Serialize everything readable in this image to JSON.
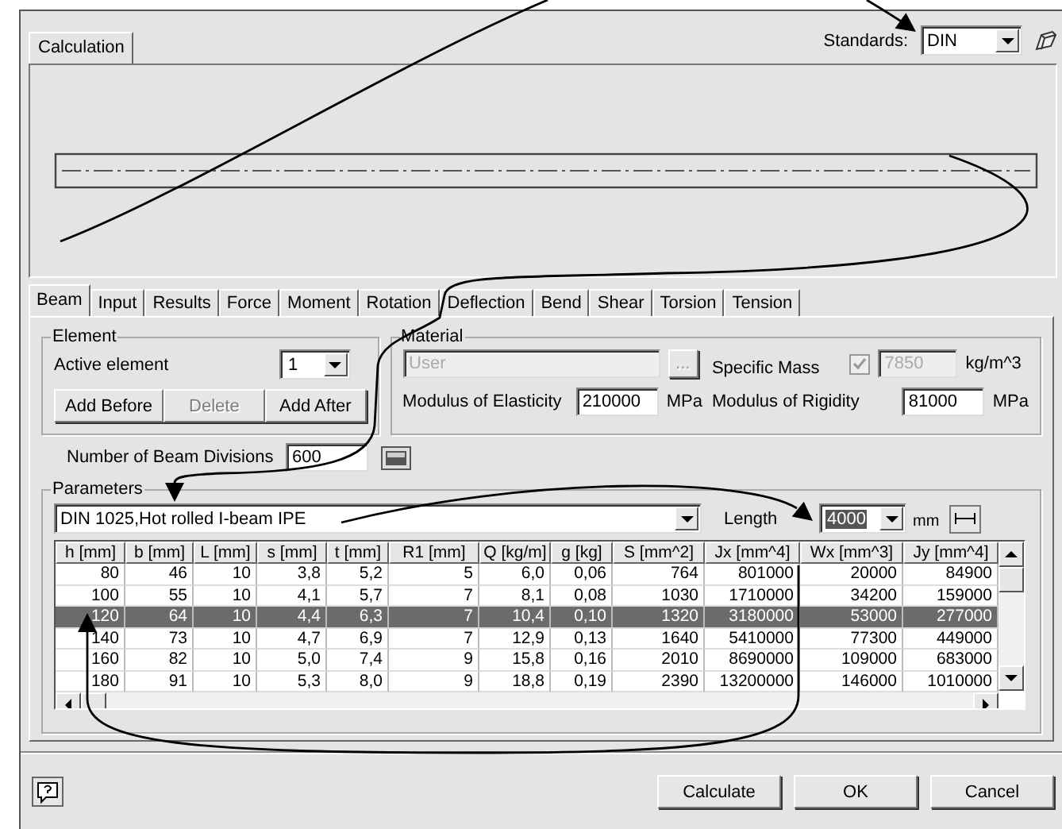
{
  "top_tabs": [
    {
      "label": "Calculation",
      "selected": true
    }
  ],
  "standards": {
    "label": "Standards:",
    "value": "DIN"
  },
  "tabs": [
    {
      "label": "Beam",
      "selected": true
    },
    {
      "label": "Input",
      "selected": false
    },
    {
      "label": "Results",
      "selected": false
    },
    {
      "label": "Force",
      "selected": false
    },
    {
      "label": "Moment",
      "selected": false
    },
    {
      "label": "Rotation",
      "selected": false
    },
    {
      "label": "Deflection",
      "selected": false
    },
    {
      "label": "Bend",
      "selected": false
    },
    {
      "label": "Shear",
      "selected": false
    },
    {
      "label": "Torsion",
      "selected": false
    },
    {
      "label": "Tension",
      "selected": false
    }
  ],
  "element": {
    "title": "Element",
    "active_label": "Active element",
    "active_value": "1",
    "buttons": [
      {
        "label": "Add Before",
        "disabled": false
      },
      {
        "label": "Delete",
        "disabled": true
      },
      {
        "label": "Add After",
        "disabled": false
      }
    ]
  },
  "material": {
    "title": "Material",
    "material_value": "User",
    "material_disabled": true,
    "browse_label": "...",
    "specific_mass_label": "Specific Mass",
    "specific_mass_checked": true,
    "specific_mass_value": "7850",
    "specific_mass_unit": "kg/m^3",
    "elasticity_label": "Modulus of Elasticity",
    "elasticity_value": "210000",
    "elasticity_unit": "MPa",
    "rigidity_label": "Modulus of Rigidity",
    "rigidity_value": "81000",
    "rigidity_unit": "MPa"
  },
  "divisions": {
    "label": "Number of Beam Divisions",
    "value": "600"
  },
  "parameters": {
    "title": "Parameters",
    "profile": "DIN 1025,Hot rolled I-beam IPE",
    "length_label": "Length",
    "length_value": "4000",
    "length_unit": "mm"
  },
  "table": {
    "columns": [
      "h  [mm]",
      "b  [mm]",
      "L  [mm]",
      "s  [mm]",
      "t  [mm]",
      "R1  [mm]",
      "Q  [kg/m]",
      "g  [kg]",
      "S  [mm^2]",
      "Jx  [mm^4]",
      "Wx  [mm^3]",
      "Jy  [mm^4]"
    ],
    "rows": [
      {
        "selected": false,
        "cells": [
          "80",
          "46",
          "10",
          "3,8",
          "5,2",
          "5",
          "6,0",
          "0,06",
          "764",
          "801000",
          "20000",
          "84900"
        ]
      },
      {
        "selected": false,
        "cells": [
          "100",
          "55",
          "10",
          "4,1",
          "5,7",
          "7",
          "8,1",
          "0,08",
          "1030",
          "1710000",
          "34200",
          "159000"
        ]
      },
      {
        "selected": true,
        "cells": [
          "120",
          "64",
          "10",
          "4,4",
          "6,3",
          "7",
          "10,4",
          "0,10",
          "1320",
          "3180000",
          "53000",
          "277000"
        ]
      },
      {
        "selected": false,
        "cells": [
          "140",
          "73",
          "10",
          "4,7",
          "6,9",
          "7",
          "12,9",
          "0,13",
          "1640",
          "5410000",
          "77300",
          "449000"
        ]
      },
      {
        "selected": false,
        "cells": [
          "160",
          "82",
          "10",
          "5,0",
          "7,4",
          "9",
          "15,8",
          "0,16",
          "2010",
          "8690000",
          "109000",
          "683000"
        ]
      },
      {
        "selected": false,
        "cells": [
          "180",
          "91",
          "10",
          "5,3",
          "8,0",
          "9",
          "18,8",
          "0,19",
          "2390",
          "13200000",
          "146000",
          "1010000"
        ]
      }
    ]
  },
  "buttons": [
    "Calculate",
    "OK",
    "Cancel"
  ]
}
